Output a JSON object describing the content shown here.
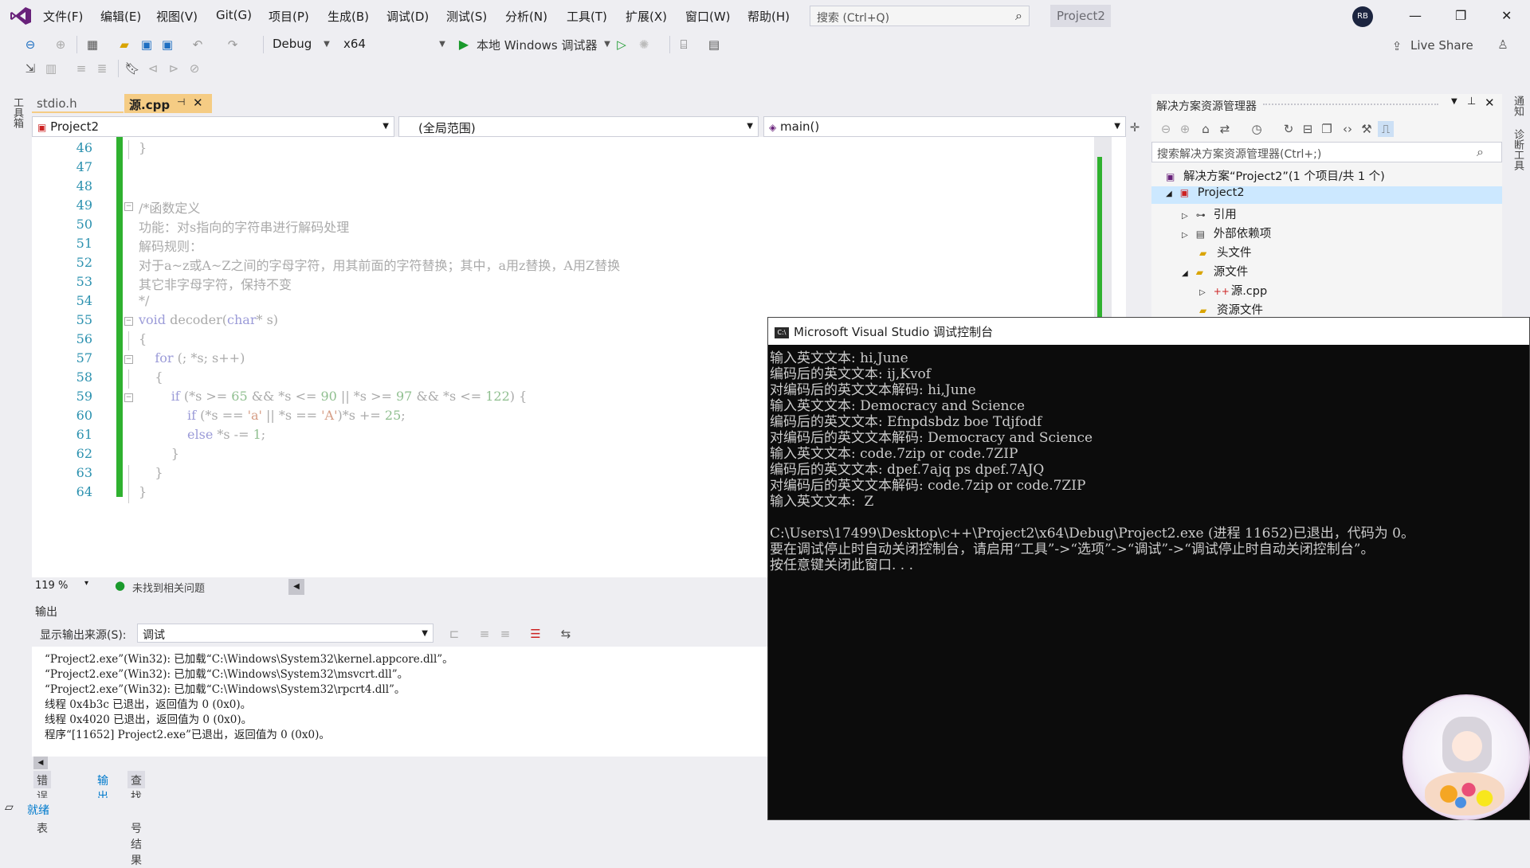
{
  "menu": [
    "文件(F)",
    "编辑(E)",
    "视图(V)",
    "Git(G)",
    "项目(P)",
    "生成(B)",
    "调试(D)",
    "测试(S)",
    "分析(N)",
    "工具(T)",
    "扩展(X)",
    "窗口(W)",
    "帮助(H)"
  ],
  "search": {
    "placeholder": "搜索 (Ctrl+Q)"
  },
  "solution_name": "Project2",
  "avatar": "RB",
  "toolbar": {
    "config": "Debug",
    "platform": "x64",
    "run_label": "本地 Windows 调试器",
    "live_share": "Live Share"
  },
  "left_strip": "工具箱",
  "right_strip": {
    "notifications": "通知",
    "diagnostics": "诊断工具"
  },
  "editor_tabs": [
    {
      "label": "stdio.h"
    },
    {
      "label": "源.cpp"
    }
  ],
  "nav": {
    "project": "Project2",
    "scope": "(全局范围)",
    "member": "main()"
  },
  "code_lines": [
    {
      "n": "46",
      "text": "}"
    },
    {
      "n": "47",
      "text": ""
    },
    {
      "n": "48",
      "text": ""
    },
    {
      "n": "49",
      "text": "/*函数定义"
    },
    {
      "n": "50",
      "text": "功能：对s指向的字符串进行解码处理"
    },
    {
      "n": "51",
      "text": "解码规则："
    },
    {
      "n": "52",
      "text": "对于a~z或A~Z之间的字母字符，用其前面的字符替换；其中，a用z替换，A用Z替换"
    },
    {
      "n": "53",
      "text": "其它非字母字符，保持不变"
    },
    {
      "n": "54",
      "text": "*/"
    },
    {
      "n": "55",
      "text": "void decoder(char* s)"
    },
    {
      "n": "56",
      "text": "{"
    },
    {
      "n": "57",
      "text": "    for (; *s; s++)"
    },
    {
      "n": "58",
      "text": "    {"
    },
    {
      "n": "59",
      "text": "        if (*s >= 65 && *s <= 90 || *s >= 97 && *s <= 122) {"
    },
    {
      "n": "60",
      "text": "            if (*s == 'a' || *s == 'A')*s += 25;"
    },
    {
      "n": "61",
      "text": "            else *s -= 1;"
    },
    {
      "n": "62",
      "text": "        }"
    },
    {
      "n": "63",
      "text": "    }"
    },
    {
      "n": "64",
      "text": "}"
    }
  ],
  "status": {
    "zoom": "119 %",
    "issues": "未找到相关问题"
  },
  "output": {
    "title": "输出",
    "source_label": "显示输出来源(S):",
    "source_value": "调试",
    "lines": [
      "“Project2.exe”(Win32): 已加载“C:\\Windows\\System32\\kernel.appcore.dll”。",
      "“Project2.exe”(Win32): 已加载“C:\\Windows\\System32\\msvcrt.dll”。",
      "“Project2.exe”(Win32): 已加载“C:\\Windows\\System32\\rpcrt4.dll”。",
      "线程 0x4b3c 已退出，返回值为 0 (0x0)。",
      "线程 0x4020 已退出，返回值为 0 (0x0)。",
      "程序“[11652] Project2.exe”已退出，返回值为 0 (0x0)。"
    ]
  },
  "bottom_tabs": [
    "错误列表",
    "输出",
    "查找符号结果"
  ],
  "statusbar": {
    "ready": "就绪"
  },
  "solution_explorer": {
    "title": "解决方案资源管理器",
    "search_placeholder": "搜索解决方案资源管理器(Ctrl+;)",
    "items": [
      {
        "label": "解决方案“Project2”(1 个项目/共 1 个)",
        "icon": "solution-icon"
      },
      {
        "label": "Project2",
        "icon": "project-icon"
      },
      {
        "label": "引用",
        "icon": "references-icon"
      },
      {
        "label": "外部依赖项",
        "icon": "external-deps-icon"
      },
      {
        "label": "头文件",
        "icon": "folder-icon"
      },
      {
        "label": "源文件",
        "icon": "folder-icon"
      },
      {
        "label": "源.cpp",
        "icon": "cpp-file-icon"
      },
      {
        "label": "资源文件",
        "icon": "folder-icon"
      }
    ]
  },
  "console": {
    "title": "Microsoft Visual Studio 调试控制台",
    "lines": [
      "输入英文文本: hi,June",
      "编码后的英文文本: ij,Kvof",
      "对编码后的英文文本解码: hi,June",
      "输入英文文本: Democracy and Science",
      "编码后的英文文本: Efnpdsbdz boe Tdjfodf",
      "对编码后的英文文本解码: Democracy and Science",
      "输入英文文本: code.7zip or code.7ZIP",
      "编码后的英文文本: dpef.7ajq ps dpef.7AJQ",
      "对编码后的英文文本解码: code.7zip or code.7ZIP",
      "输入英文文本:  Z",
      "",
      "C:\\Users\\17499\\Desktop\\c++\\Project2\\x64\\Debug\\Project2.exe (进程 11652)已退出，代码为 0。",
      "要在调试停止时自动关闭控制台，请启用“工具”->“选项”->“调试”->“调试停止时自动关闭控制台”。",
      "按任意键关闭此窗口. . ."
    ]
  }
}
